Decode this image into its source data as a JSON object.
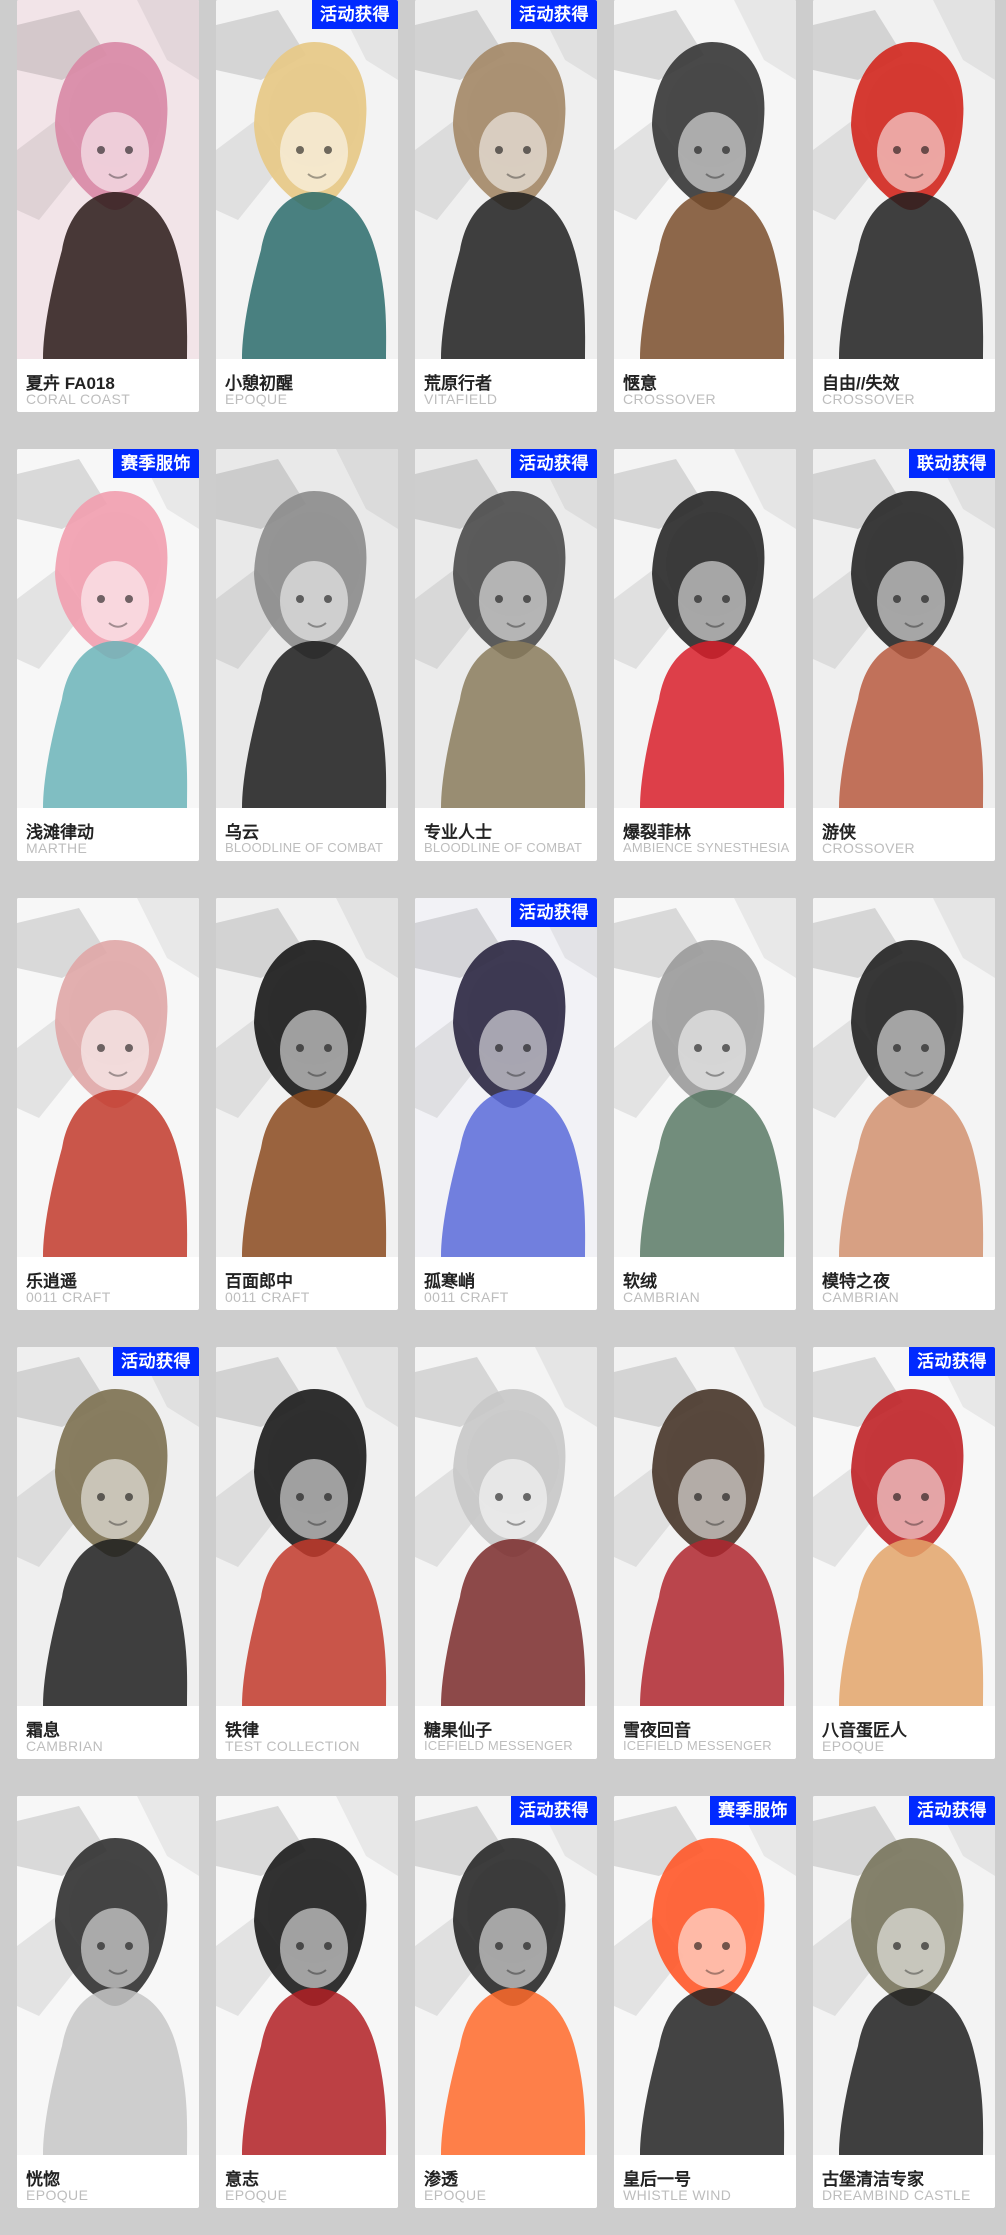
{
  "cards": [
    {
      "row": 0,
      "col": 0,
      "name": "夏卉 FA018",
      "brand": "CORAL COAST",
      "tag": "",
      "palette": {
        "bg": "#f2e4e8",
        "main": "#d98aa6",
        "accent": "#2a1a18"
      }
    },
    {
      "row": 0,
      "col": 1,
      "name": "小憩初醒",
      "brand": "EPOQUE",
      "tag": "活动获得",
      "palette": {
        "bg": "#f3f3f3",
        "main": "#e7c987",
        "accent": "#2a6b6b"
      }
    },
    {
      "row": 0,
      "col": 2,
      "name": "荒原行者",
      "brand": "VITAFIELD",
      "tag": "活动获得",
      "palette": {
        "bg": "#efefef",
        "main": "#a58a69",
        "accent": "#1f1f1f"
      }
    },
    {
      "row": 0,
      "col": 3,
      "name": "惬意",
      "brand": "CROSSOVER",
      "tag": "",
      "palette": {
        "bg": "#f6f6f6",
        "main": "#3a3a3a",
        "accent": "#7a4d2b"
      }
    },
    {
      "row": 0,
      "col": 4,
      "name": "自由//失效",
      "brand": "CROSSOVER",
      "tag": "",
      "palette": {
        "bg": "#f1f1f1",
        "main": "#d32a22",
        "accent": "#202020"
      }
    },
    {
      "row": 1,
      "col": 0,
      "name": "浅滩律动",
      "brand": "MARTHE",
      "tag": "赛季服饰",
      "palette": {
        "bg": "#f7f7f7",
        "main": "#f1a0b0",
        "accent": "#6bb4b8"
      }
    },
    {
      "row": 1,
      "col": 1,
      "name": "乌云",
      "brand": "BLOODLINE OF COMBAT",
      "tag": "",
      "palette": {
        "bg": "#e9e9e9",
        "main": "#8d8d8d",
        "accent": "#1c1c1c"
      }
    },
    {
      "row": 1,
      "col": 2,
      "name": "专业人士",
      "brand": "BLOODLINE OF COMBAT",
      "tag": "活动获得",
      "palette": {
        "bg": "#ebebeb",
        "main": "#4e4e4e",
        "accent": "#8b7c5d"
      }
    },
    {
      "row": 1,
      "col": 3,
      "name": "爆裂菲林",
      "brand": "AMBIENCE SYNESTHESIA",
      "tag": "",
      "palette": {
        "bg": "#f4f4f4",
        "main": "#2b2b2b",
        "accent": "#d81e2a"
      }
    },
    {
      "row": 1,
      "col": 4,
      "name": "游侠",
      "brand": "CROSSOVER",
      "tag": "联动获得",
      "palette": {
        "bg": "#efefef",
        "main": "#2a2a2a",
        "accent": "#b85a40"
      }
    },
    {
      "row": 2,
      "col": 0,
      "name": "乐逍遥",
      "brand": "0011 CRAFT",
      "tag": "",
      "palette": {
        "bg": "#f7f7f7",
        "main": "#e0a8a8",
        "accent": "#c23a2c"
      }
    },
    {
      "row": 2,
      "col": 1,
      "name": "百面郎中",
      "brand": "0011 CRAFT",
      "tag": "",
      "palette": {
        "bg": "#f1f1f1",
        "main": "#1c1c1c",
        "accent": "#8b4a1f"
      }
    },
    {
      "row": 2,
      "col": 2,
      "name": "孤寒峭",
      "brand": "0011 CRAFT",
      "tag": "活动获得",
      "palette": {
        "bg": "#f2f2f6",
        "main": "#2f2a44",
        "accent": "#5a6bd9"
      }
    },
    {
      "row": 2,
      "col": 3,
      "name": "软绒",
      "brand": "CAMBRIAN",
      "tag": "",
      "palette": {
        "bg": "#f7f7f7",
        "main": "#9c9c9c",
        "accent": "#5b7a66"
      }
    },
    {
      "row": 2,
      "col": 4,
      "name": "模特之夜",
      "brand": "CAMBRIAN",
      "tag": "",
      "palette": {
        "bg": "#f4f4f4",
        "main": "#262626",
        "accent": "#d1906e"
      }
    },
    {
      "row": 3,
      "col": 0,
      "name": "霜息",
      "brand": "CAMBRIAN",
      "tag": "活动获得",
      "palette": {
        "bg": "#efefef",
        "main": "#7f7354",
        "accent": "#1f1f1f"
      }
    },
    {
      "row": 3,
      "col": 1,
      "name": "铁律",
      "brand": "TEST COLLECTION",
      "tag": "",
      "palette": {
        "bg": "#f0f0f0",
        "main": "#1e1e1e",
        "accent": "#c23a2c"
      }
    },
    {
      "row": 3,
      "col": 2,
      "name": "糖果仙子",
      "brand": "ICEFIELD MESSENGER",
      "tag": "",
      "palette": {
        "bg": "#f4f4f4",
        "main": "#c8c8c8",
        "accent": "#7a2a2a"
      }
    },
    {
      "row": 3,
      "col": 3,
      "name": "雪夜回音",
      "brand": "ICEFIELD MESSENGER",
      "tag": "",
      "palette": {
        "bg": "#f2f2f2",
        "main": "#4b3a2e",
        "accent": "#b0272f"
      }
    },
    {
      "row": 3,
      "col": 4,
      "name": "八音蛋匠人",
      "brand": "EPOQUE",
      "tag": "活动获得",
      "palette": {
        "bg": "#f7f7f7",
        "main": "#c0262a",
        "accent": "#e3a46a"
      }
    },
    {
      "row": 4,
      "col": 0,
      "name": "恍惚",
      "brand": "EPOQUE",
      "tag": "",
      "palette": {
        "bg": "#f7f7f7",
        "main": "#343434",
        "accent": "#c7c7c7"
      }
    },
    {
      "row": 4,
      "col": 1,
      "name": "意志",
      "brand": "EPOQUE",
      "tag": "",
      "palette": {
        "bg": "#f7f7f7",
        "main": "#1f1f1f",
        "accent": "#b22024"
      }
    },
    {
      "row": 4,
      "col": 2,
      "name": "渗透",
      "brand": "EPOQUE",
      "tag": "活动获得",
      "palette": {
        "bg": "#f4f4f4",
        "main": "#2c2c2c",
        "accent": "#ff6a2a"
      }
    },
    {
      "row": 4,
      "col": 3,
      "name": "皇后一号",
      "brand": "WHISTLE WIND",
      "tag": "赛季服饰",
      "palette": {
        "bg": "#f7f7f7",
        "main": "#ff5a2c",
        "accent": "#232323"
      }
    },
    {
      "row": 4,
      "col": 4,
      "name": "古堡清洁专家",
      "brand": "DREAMBIND CASTLE",
      "tag": "活动获得",
      "palette": {
        "bg": "#f3f3f3",
        "main": "#7b775f",
        "accent": "#1f1f1f"
      }
    }
  ]
}
